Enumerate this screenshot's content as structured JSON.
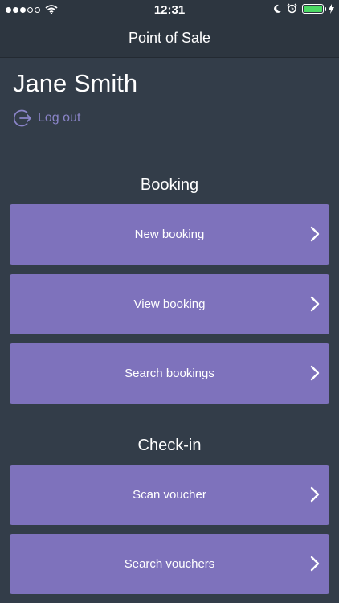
{
  "status_bar": {
    "time": "12:31",
    "signal_dots": [
      true,
      true,
      true,
      false,
      false
    ],
    "icons": [
      "wifi-icon",
      "moon-icon",
      "alarm-icon",
      "battery-icon",
      "charging-icon"
    ],
    "battery_color": "#4cd964"
  },
  "navbar": {
    "title": "Point of Sale"
  },
  "user": {
    "name": "Jane Smith",
    "logout_label": "Log out",
    "logout_icon": "logout-icon"
  },
  "sections": [
    {
      "title": "Booking",
      "buttons": [
        {
          "label": "New booking"
        },
        {
          "label": "View booking"
        },
        {
          "label": "Search bookings"
        }
      ]
    },
    {
      "title": "Check-in",
      "buttons": [
        {
          "label": "Scan voucher"
        },
        {
          "label": "Search vouchers"
        }
      ]
    }
  ],
  "colors": {
    "background": "#333d49",
    "button": "#7e72bc",
    "accent_link": "#8a84c8"
  }
}
